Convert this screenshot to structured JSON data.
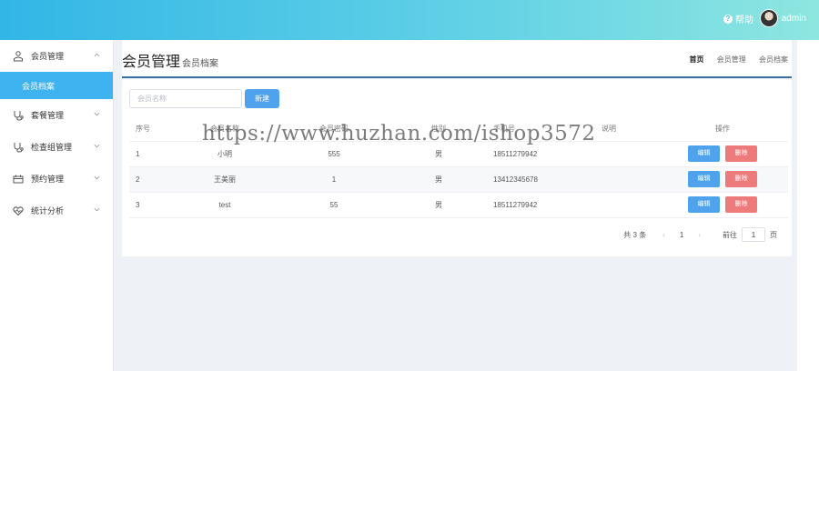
{
  "header": {
    "help_label": "帮助",
    "username": "admin"
  },
  "sidebar": {
    "items": [
      {
        "label": "会员管理",
        "icon": "member-icon",
        "expanded": true
      },
      {
        "label": "套餐管理",
        "icon": "stethoscope-icon",
        "expanded": false
      },
      {
        "label": "检查组管理",
        "icon": "stethoscope-icon",
        "expanded": false
      },
      {
        "label": "预约管理",
        "icon": "calendar-icon",
        "expanded": false
      },
      {
        "label": "统计分析",
        "icon": "heartbeat-icon",
        "expanded": false
      }
    ],
    "sub_active": "会员档案"
  },
  "page": {
    "title": "会员管理",
    "subtitle": "会员档案",
    "breadcrumb": [
      "首页",
      "会员管理",
      "会员档案"
    ]
  },
  "toolbar": {
    "search_placeholder": "会员名称",
    "new_label": "新建"
  },
  "table": {
    "headers": [
      "序号",
      "会员名称",
      "会员密码",
      "性别",
      "手机号",
      "说明",
      "操作"
    ],
    "rows": [
      {
        "idx": "1",
        "name": "小明",
        "code": "555",
        "sex": "男",
        "phone": "18511279942",
        "note": ""
      },
      {
        "idx": "2",
        "name": "王美丽",
        "code": "1",
        "sex": "男",
        "phone": "13412345678",
        "note": ""
      },
      {
        "idx": "3",
        "name": "test",
        "code": "55",
        "sex": "男",
        "phone": "18511279942",
        "note": ""
      }
    ],
    "edit_label": "编辑",
    "delete_label": "删除"
  },
  "pagination": {
    "total_text": "共 3 条",
    "prev": "‹",
    "current": "1",
    "next": "›",
    "goto_label": "前往",
    "goto_value": "1",
    "page_suffix": "页"
  },
  "watermark": "https://www.huzhan.com/ishop3572",
  "colors": {
    "header_gradient_start": "#32b6e6",
    "header_gradient_end": "#8ee6e0",
    "active_menu": "#3fb2f0",
    "primary_button": "#4fa3ec",
    "danger_button": "#ee7b7b",
    "main_bg": "#eef1f5"
  }
}
